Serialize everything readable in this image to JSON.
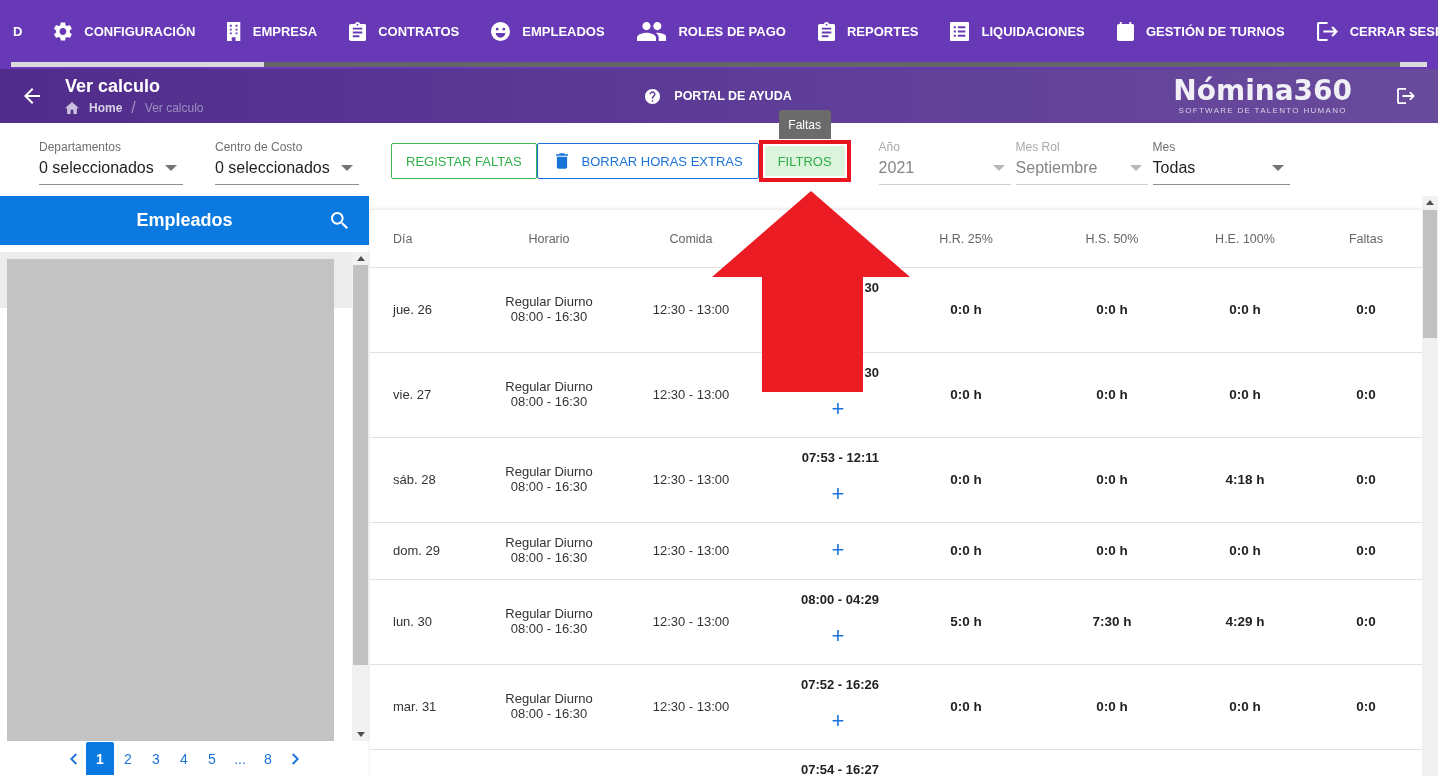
{
  "nav": {
    "tabs": [
      "D",
      "CONFIGURACIÓN",
      "EMPRESA",
      "CONTRATOS",
      "EMPLEADOS",
      "ROLES DE PAGO",
      "REPORTES",
      "LIQUIDACIONES",
      "GESTIÓN DE TURNOS",
      "CERRAR SESI"
    ]
  },
  "header": {
    "title": "Ver calculo",
    "breadcrumb": [
      {
        "label": "Home",
        "current": false
      },
      {
        "label": "Ver calculo",
        "current": true
      }
    ],
    "breadcrumb_separator": "/",
    "help_link": "PORTAL DE AYUDA",
    "logo": {
      "wordmark": "Nómina360",
      "tagline": "SOFTWARE DE TALENTO HUMANO"
    }
  },
  "filters": {
    "selects": [
      {
        "label": "Departamentos",
        "value": "0 seleccionados",
        "disabled": false
      },
      {
        "label": "Centro de Costo",
        "value": "0 seleccionados",
        "disabled": false
      }
    ],
    "buttons": [
      {
        "label": "REGISTAR FALTAS",
        "kind": "outlined-success",
        "highlighted": false
      },
      {
        "label": "BORRAR HORAS EXTRAS",
        "kind": "outlined-primary",
        "highlighted": false
      },
      {
        "label": "FILTROS",
        "kind": "tonal-success",
        "highlighted": true,
        "tooltip": "Faltas"
      }
    ],
    "period_selects": [
      {
        "label": "Año",
        "value": "2021",
        "disabled": true
      },
      {
        "label": "Mes Rol",
        "value": "Septiembre",
        "disabled": true
      },
      {
        "label": "Mes",
        "value": "Todas",
        "disabled": false
      }
    ]
  },
  "employees": {
    "title": "Empleados",
    "pages": [
      {
        "label": "1",
        "selected": true
      },
      {
        "label": "2",
        "selected": false
      },
      {
        "label": "3",
        "selected": false
      },
      {
        "label": "4",
        "selected": false
      },
      {
        "label": "5",
        "selected": false
      },
      {
        "label": "...",
        "selected": false
      },
      {
        "label": "8",
        "selected": false
      }
    ]
  },
  "table": {
    "columns": [
      "Día",
      "Horario",
      "Comida",
      "H.R. 25%",
      "H.S. 50%",
      "H.E. 100%",
      "Faltas"
    ],
    "rows": [
      {
        "day": "jue. 26",
        "schedule": "Regular Diurno\n08:00 - 16:30",
        "meal": "12:30 - 13:00",
        "column_4": {
          "times": "30"
        },
        "hr_25": "0:0 h",
        "hs_50": "0:0 h",
        "he_100": "0:0 h",
        "absences": "0:0"
      },
      {
        "day": "vie. 27",
        "schedule": "Regular Diurno\n08:00 - 16:30",
        "meal": "12:30 - 13:00",
        "column_4": {
          "times": "30",
          "add": "+"
        },
        "hr_25": "0:0 h",
        "hs_50": "0:0 h",
        "he_100": "0:0 h",
        "absences": "0:0"
      },
      {
        "day": "sáb. 28",
        "schedule": "Regular Diurno\n08:00 - 16:30",
        "meal": "12:30 - 13:00",
        "column_4": {
          "times": "07:53 - 12:11",
          "add": "+"
        },
        "hr_25": "0:0 h",
        "hs_50": "0:0 h",
        "he_100": "4:18 h",
        "absences": "0:0"
      },
      {
        "day": "dom. 29",
        "schedule": "Regular Diurno\n08:00 - 16:30",
        "meal": "12:30 - 13:00",
        "column_4": {
          "add": "+"
        },
        "hr_25": "0:0 h",
        "hs_50": "0:0 h",
        "he_100": "0:0 h",
        "absences": "0:0"
      },
      {
        "day": "lun. 30",
        "schedule": "Regular Diurno\n08:00 - 16:30",
        "meal": "12:30 - 13:00",
        "column_4": {
          "times": "08:00 - 04:29",
          "add": "+"
        },
        "hr_25": "5:0 h",
        "hs_50": "7:30 h",
        "he_100": "4:29 h",
        "absences": "0:0"
      },
      {
        "day": "mar. 31",
        "schedule": "Regular Diurno\n08:00 - 16:30",
        "meal": "12:30 - 13:00",
        "column_4": {
          "times": "07:52 - 16:26",
          "add": "+"
        },
        "hr_25": "0:0 h",
        "hs_50": "0:0 h",
        "he_100": "0:0 h",
        "absences": "0:0"
      },
      {
        "column_4": {
          "times": "07:54 - 16:27"
        }
      }
    ]
  }
}
